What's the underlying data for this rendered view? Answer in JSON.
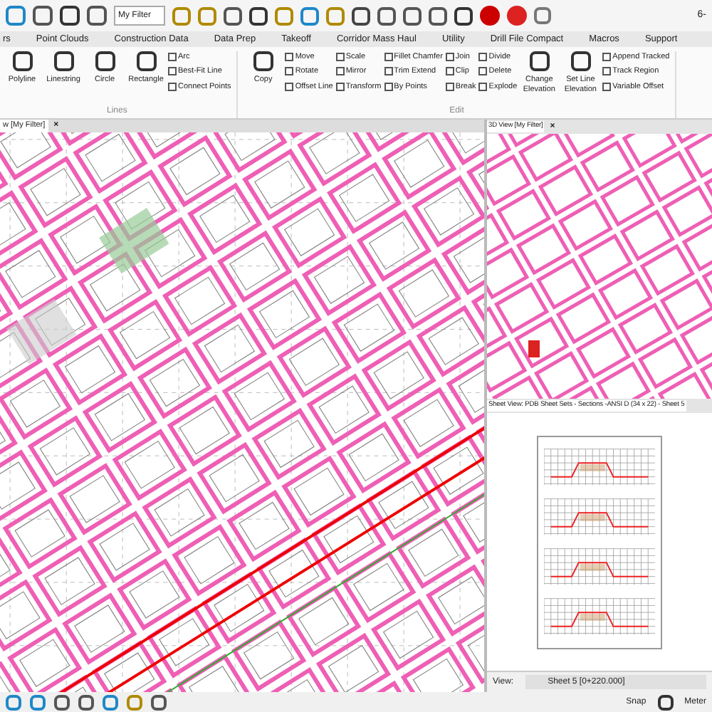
{
  "quick_toolbar": {
    "filter": "My Filter",
    "cut_text": "6-"
  },
  "ribbon_tabs": [
    {
      "label": "rs",
      "selected": false
    },
    {
      "label": "Point Clouds",
      "selected": false
    },
    {
      "label": "Construction Data",
      "selected": false
    },
    {
      "label": "Data Prep",
      "selected": false
    },
    {
      "label": "Takeoff",
      "selected": false
    },
    {
      "label": "Corridor Mass Haul",
      "selected": false
    },
    {
      "label": "Utility",
      "selected": false
    },
    {
      "label": "Drill File Compact",
      "selected": false
    },
    {
      "label": "Macros",
      "selected": false
    },
    {
      "label": "Support",
      "selected": false
    }
  ],
  "groups": [
    {
      "label": "Lines",
      "large": [
        "Polyline",
        "Linestring",
        "Circle",
        "Rectangle"
      ],
      "small": [
        [
          "Arc",
          "Best-Fit Line",
          "Connect Points"
        ]
      ]
    },
    {
      "label": "Edit",
      "large": [
        "Copy"
      ],
      "small": [
        [
          "Move",
          "Rotate",
          "Offset Line"
        ],
        [
          "Scale",
          "Mirror",
          "Transform"
        ],
        [
          "Fillet Chamfer",
          "Trim Extend",
          "By Points"
        ],
        [
          "Join",
          "Clip",
          "Break"
        ],
        [
          "Divide",
          "Delete",
          "Explode"
        ]
      ],
      "large_after": [
        "Change Elevation",
        "Set Line Elevation"
      ],
      "small_after": [
        [
          "Append Tracked",
          "Track Region",
          "Variable Offset"
        ]
      ]
    }
  ],
  "views": [
    {
      "title": "w [My Filter]",
      "close": "×"
    },
    {
      "title": "3D View [My Filter]",
      "close": "×"
    },
    {
      "title": "Sheet View: PDB Sheet Sets - Sections -ANSI D (34 x 22) - Sheet 5"
    }
  ],
  "sheet_footer": {
    "label": "View:",
    "value": "Sheet 5 [0+220.000]"
  },
  "status_bar": {
    "items": [
      "Snap",
      "Meter"
    ]
  }
}
